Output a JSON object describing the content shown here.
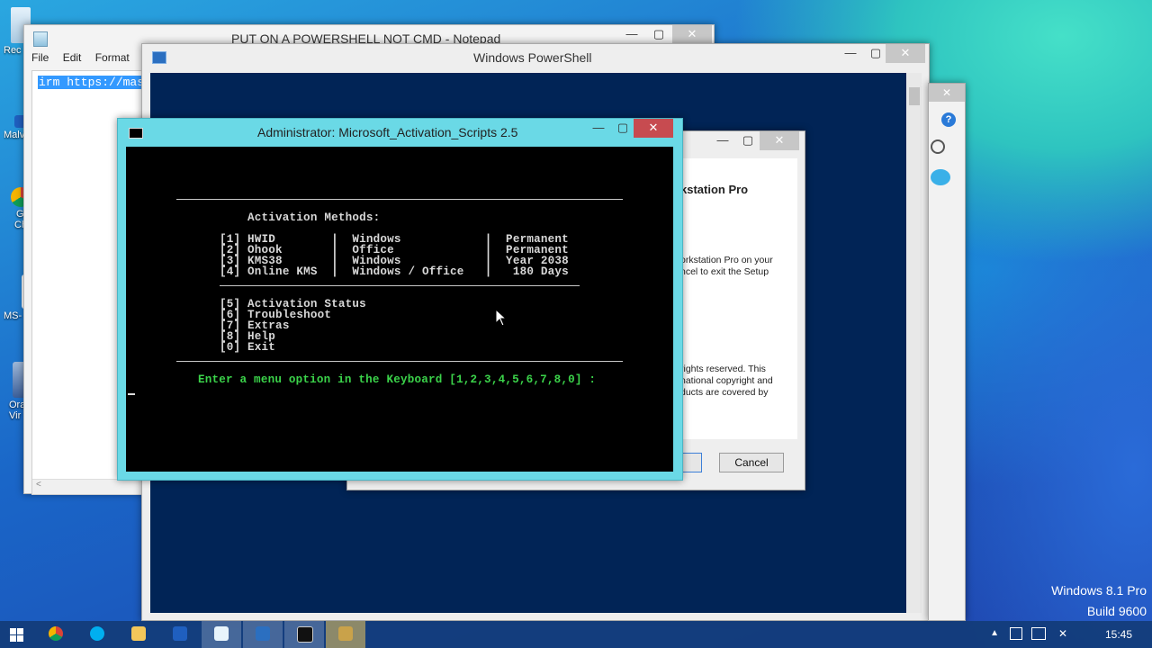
{
  "desktop": {
    "icons": [
      {
        "label": "Rec",
        "top": 0
      },
      {
        "label": "Malv",
        "top": 0
      },
      {
        "label": "G",
        "top": 0
      },
      {
        "label": "Ch",
        "top": 0
      },
      {
        "label": "MS-",
        "top": 0
      },
      {
        "label": "Ora",
        "top": 0
      },
      {
        "label": "Vir",
        "top": 0
      }
    ],
    "watermark_line1": "Windows 8.1 Pro",
    "watermark_line2": "Build 9600"
  },
  "notepad": {
    "title": "PUT ON A POWERSHELL NOT CMD - Notepad",
    "menu": [
      "File",
      "Edit",
      "Format"
    ],
    "selected_text": "irm https://mas"
  },
  "powershell": {
    "title": "Windows PowerShell"
  },
  "setup": {
    "heading": "kstation Pro",
    "line1": "orkstation Pro on your",
    "line2": "ncel to exit the Setup",
    "copy1": "rights reserved. This",
    "copy2": "national copyright and",
    "copy3": "ducts are covered by",
    "cancel": "Cancel"
  },
  "cmd": {
    "title": "Administrator:  Microsoft_Activation_Scripts 2.5",
    "heading": "Activation Methods:",
    "methods": [
      "[1] HWID        |  Windows            |  Permanent",
      "[2] Ohook       |  Office             |  Permanent",
      "[3] KMS38       |  Windows            |  Year 2038",
      "[4] Online KMS  |  Windows / Office   |   180 Days"
    ],
    "options": [
      "[5] Activation Status",
      "[6] Troubleshoot",
      "[7] Extras",
      "[8] Help",
      "[0] Exit"
    ],
    "prompt": "Enter a menu option in the Keyboard [1,2,3,4,5,6,7,8,0] :"
  },
  "taskbar": {
    "time": "15:45"
  },
  "colors": {
    "cmd_frame": "#6ad9e6",
    "prompt_green": "#3bd34a",
    "ps_background": "#012456",
    "selection": "#3399ff"
  }
}
